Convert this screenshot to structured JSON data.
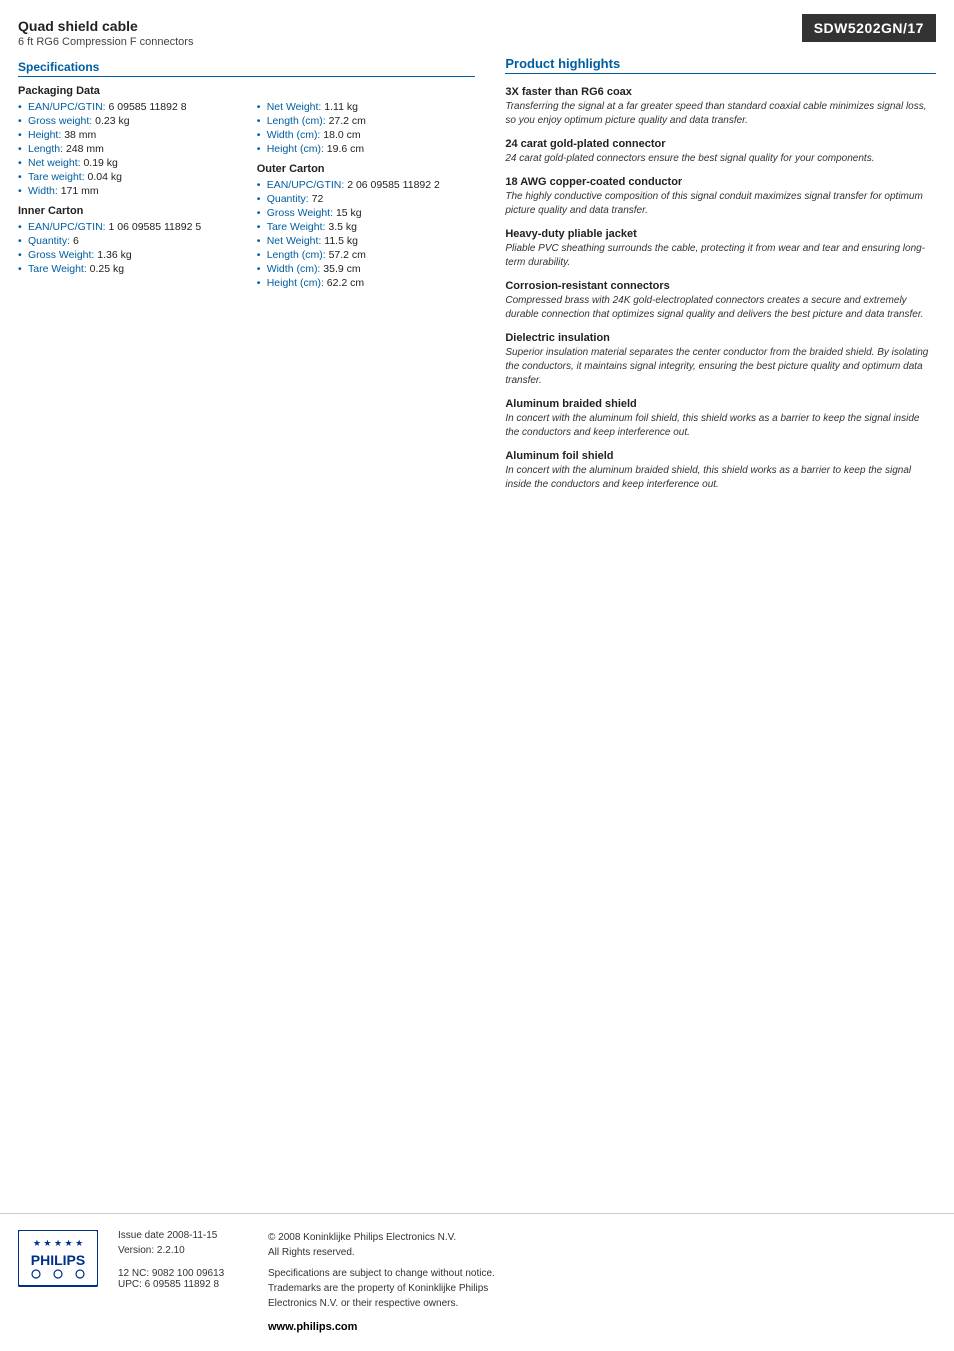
{
  "product": {
    "name": "Quad shield cable",
    "subtitle": "6 ft RG6 Compression F connectors",
    "model": "SDW5202GN/17"
  },
  "sections": {
    "specifications_label": "Specifications",
    "product_highlights_label": "Product highlights"
  },
  "packaging_data": {
    "heading": "Packaging Data",
    "items": [
      {
        "label": "EAN/UPC/GTIN:",
        "value": "6 09585 11892 8"
      },
      {
        "label": "Gross weight:",
        "value": "0.23 kg"
      },
      {
        "label": "Height:",
        "value": "38 mm"
      },
      {
        "label": "Length:",
        "value": "248 mm"
      },
      {
        "label": "Net weight:",
        "value": "0.19 kg"
      },
      {
        "label": "Tare weight:",
        "value": "0.04 kg"
      },
      {
        "label": "Width:",
        "value": "171 mm"
      }
    ]
  },
  "inner_carton": {
    "heading": "Inner Carton",
    "items": [
      {
        "label": "EAN/UPC/GTIN:",
        "value": "1 06 09585 11892 5"
      },
      {
        "label": "Quantity:",
        "value": "6"
      },
      {
        "label": "Gross Weight:",
        "value": "1.36 kg"
      },
      {
        "label": "Tare Weight:",
        "value": "0.25 kg"
      }
    ]
  },
  "packaging_col2": {
    "items": [
      {
        "label": "Net Weight:",
        "value": "1.11 kg"
      },
      {
        "label": "Length (cm):",
        "value": "27.2 cm"
      },
      {
        "label": "Width (cm):",
        "value": "18.0 cm"
      },
      {
        "label": "Height (cm):",
        "value": "19.6 cm"
      }
    ]
  },
  "outer_carton": {
    "heading": "Outer Carton",
    "items": [
      {
        "label": "EAN/UPC/GTIN:",
        "value": "2 06 09585 11892 2"
      },
      {
        "label": "Quantity:",
        "value": "72"
      },
      {
        "label": "Gross Weight:",
        "value": "15 kg"
      },
      {
        "label": "Tare Weight:",
        "value": "3.5 kg"
      },
      {
        "label": "Net Weight:",
        "value": "11.5 kg"
      },
      {
        "label": "Length (cm):",
        "value": "57.2 cm"
      },
      {
        "label": "Width (cm):",
        "value": "35.9 cm"
      },
      {
        "label": "Height (cm):",
        "value": "62.2 cm"
      }
    ]
  },
  "highlights": [
    {
      "title": "3X faster than RG6 coax",
      "desc": "Transferring the signal at a far greater speed than standard coaxial cable minimizes signal loss, so you enjoy optimum picture quality and data transfer."
    },
    {
      "title": "24 carat gold-plated connector",
      "desc": "24 carat gold-plated connectors ensure the best signal quality for your components."
    },
    {
      "title": "18 AWG copper-coated conductor",
      "desc": "The highly conductive composition of this signal conduit maximizes signal transfer for optimum picture quality and data transfer."
    },
    {
      "title": "Heavy-duty pliable jacket",
      "desc": "Pliable PVC sheathing surrounds the cable, protecting it from wear and tear and ensuring long-term durability."
    },
    {
      "title": "Corrosion-resistant connectors",
      "desc": "Compressed brass with 24K gold-electroplated connectors creates a secure and extremely durable connection that optimizes signal quality and delivers the best picture and data transfer."
    },
    {
      "title": "Dielectric insulation",
      "desc": "Superior insulation material separates the center conductor from the braided shield. By isolating the conductors, it maintains signal integrity, ensuring the best picture quality and optimum data transfer."
    },
    {
      "title": "Aluminum braided shield",
      "desc": "In concert with the aluminum foil shield, this shield works as a barrier to keep the signal inside the conductors and keep interference out."
    },
    {
      "title": "Aluminum foil shield",
      "desc": "In concert with the aluminum braided shield, this shield works as a barrier to keep the signal inside the conductors and keep interference out."
    }
  ],
  "footer": {
    "issue_date_label": "Issue date",
    "issue_date": "2008-11-15",
    "version_label": "Version:",
    "version": "2.2.10",
    "nc_upc": "12 NC: 9082 100 09613\nUPC: 6 09585 11892 8",
    "copyright": "© 2008 Koninklijke Philips Electronics N.V.\nAll Rights reserved.",
    "legal": "Specifications are subject to change without notice.\nTrademarks are the property of Koninklijke Philips\nElectronics N.V. or their respective owners.",
    "website": "www.philips.com"
  }
}
